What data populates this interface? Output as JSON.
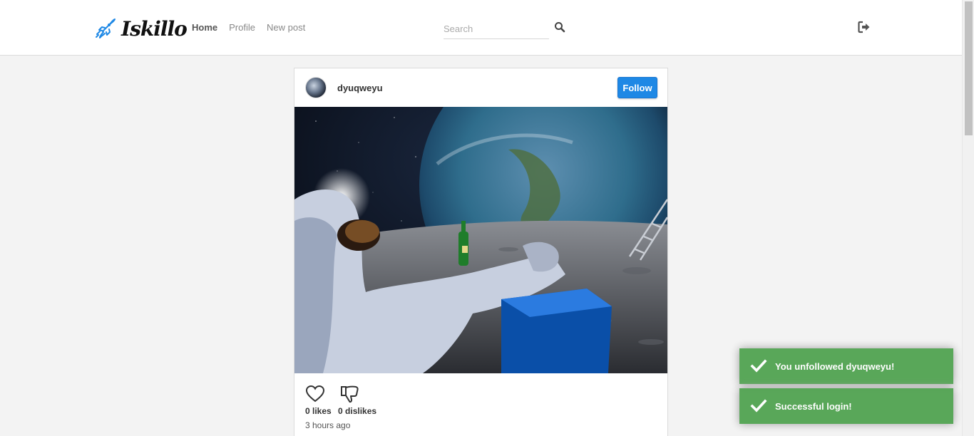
{
  "app": {
    "logo_text": "Iskillo"
  },
  "nav": {
    "items": [
      {
        "label": "Home",
        "active": true
      },
      {
        "label": "Profile",
        "active": false
      },
      {
        "label": "New post",
        "active": false
      }
    ]
  },
  "search": {
    "placeholder": "Search",
    "value": "",
    "icon": "search-icon"
  },
  "header_actions": {
    "logout_icon": "sign-out-icon"
  },
  "post": {
    "username": "dyuqweyu",
    "follow_label": "Follow",
    "image_alt": "Astronaut relaxing on the moon with a bottle, Earth in background",
    "likes": "0 likes",
    "dislikes": "0 dislikes",
    "time": "3 hours ago",
    "like_icon": "heart-icon",
    "dislike_icon": "thumbs-down-icon"
  },
  "toasts": [
    {
      "message": "You unfollowed dyuqweyu!",
      "icon": "check-icon"
    },
    {
      "message": "Successful login!",
      "icon": "check-icon"
    }
  ],
  "colors": {
    "accent": "#1e88e5",
    "toast_success": "#51a351",
    "background": "#f3f3f3"
  }
}
